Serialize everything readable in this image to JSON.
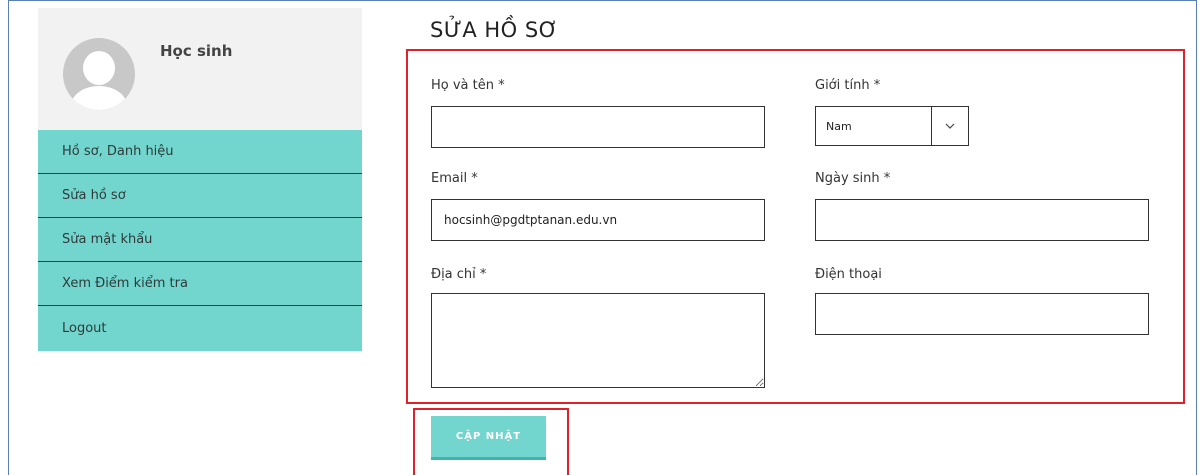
{
  "sidebar": {
    "role_name": "Học sinh",
    "items": [
      {
        "label": "Hồ sơ, Danh hiệu"
      },
      {
        "label": "Sửa hồ sơ"
      },
      {
        "label": "Sửa mật khẩu"
      },
      {
        "label": "Xem Điểm kiểm tra"
      },
      {
        "label": "Logout"
      }
    ]
  },
  "main": {
    "title": "SỬA HỒ SƠ",
    "form": {
      "full_name": {
        "label": "Họ và tên *",
        "value": ""
      },
      "gender": {
        "label": "Giới tính *",
        "value": "Nam"
      },
      "email": {
        "label": "Email *",
        "value": "hocsinh@pgdtptanan.edu.vn"
      },
      "birthday": {
        "label": "Ngày sinh *",
        "value": ""
      },
      "address": {
        "label": "Địa chỉ *",
        "value": ""
      },
      "phone": {
        "label": "Điện thoại",
        "value": ""
      }
    },
    "submit_label": "CẬP NHẬT"
  },
  "colors": {
    "accent": "#72d6ce",
    "highlight_border": "#e0202a"
  }
}
